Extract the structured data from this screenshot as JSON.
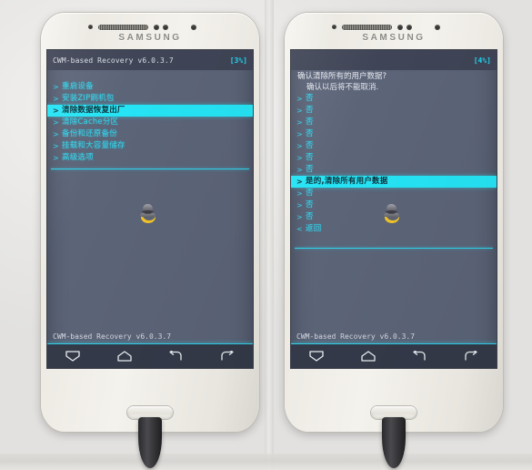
{
  "scene": {
    "device_brand": "SAMSUNG",
    "background_color": "#ebeae8",
    "screen_bg_color": "#5c6478",
    "accent_cyan": "#2fd4ec",
    "highlight_color": "#25e4f5"
  },
  "phones": [
    {
      "position": "left",
      "header": {
        "title": "CWM-based Recovery v6.0.3.7",
        "battery": "[3%]"
      },
      "prompt_lines": [],
      "menu": [
        {
          "chevron": ">",
          "label": "重启设备",
          "selected": false
        },
        {
          "chevron": ">",
          "label": "安装ZIP刷机包",
          "selected": false
        },
        {
          "chevron": ">",
          "label": "清除数据恢复出厂",
          "selected": true
        },
        {
          "chevron": ">",
          "label": "清除Cache分区",
          "selected": false
        },
        {
          "chevron": ">",
          "label": "备份和还原备份",
          "selected": false
        },
        {
          "chevron": ">",
          "label": "挂载和大容量储存",
          "selected": false
        },
        {
          "chevron": ">",
          "label": "高级选项",
          "selected": false
        }
      ],
      "footer": "CWM-based Recovery v6.0.3.7",
      "nav_buttons": [
        {
          "icon": "volume-down-icon"
        },
        {
          "icon": "home-icon"
        },
        {
          "icon": "back-icon"
        },
        {
          "icon": "enter-icon"
        }
      ]
    },
    {
      "position": "right",
      "header": {
        "title": "",
        "battery": "[4%]"
      },
      "prompt_lines": [
        "确认清除所有的用户数据?",
        "确认以后将不能取消."
      ],
      "menu": [
        {
          "chevron": ">",
          "label": "否",
          "selected": false
        },
        {
          "chevron": ">",
          "label": "否",
          "selected": false
        },
        {
          "chevron": ">",
          "label": "否",
          "selected": false
        },
        {
          "chevron": ">",
          "label": "否",
          "selected": false
        },
        {
          "chevron": ">",
          "label": "否",
          "selected": false
        },
        {
          "chevron": ">",
          "label": "否",
          "selected": false
        },
        {
          "chevron": ">",
          "label": "否",
          "selected": false
        },
        {
          "chevron": ">",
          "label": "是的,清除所有用户数据",
          "selected": true
        },
        {
          "chevron": ">",
          "label": "否",
          "selected": false
        },
        {
          "chevron": ">",
          "label": "否",
          "selected": false
        },
        {
          "chevron": ">",
          "label": "否",
          "selected": false
        },
        {
          "chevron": "<",
          "label": "返回",
          "selected": false
        }
      ],
      "footer": "CWM-based Recovery v6.0.3.7",
      "nav_buttons": [
        {
          "icon": "volume-down-icon"
        },
        {
          "icon": "home-icon"
        },
        {
          "icon": "back-icon"
        },
        {
          "icon": "enter-icon"
        }
      ]
    }
  ]
}
